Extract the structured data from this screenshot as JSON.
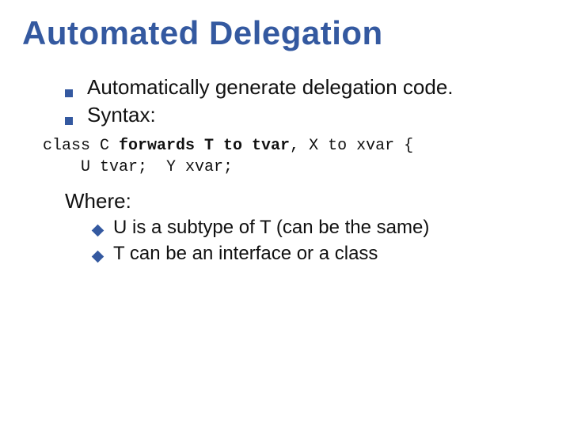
{
  "title": "Automated Delegation",
  "bullets": [
    "Automatically generate delegation code.",
    "Syntax:"
  ],
  "code": {
    "plain1": "class C ",
    "bold1": "forwards T to tvar",
    "plain2": ", X to xvar {",
    "line2_indent": "    U tvar;  Y xvar;"
  },
  "where": {
    "label": "Where:",
    "items": [
      {
        "lead": "U",
        "rest": " is a subtype of T (can be the same)"
      },
      {
        "lead": "T",
        "rest": " can be an interface or a class"
      }
    ]
  }
}
